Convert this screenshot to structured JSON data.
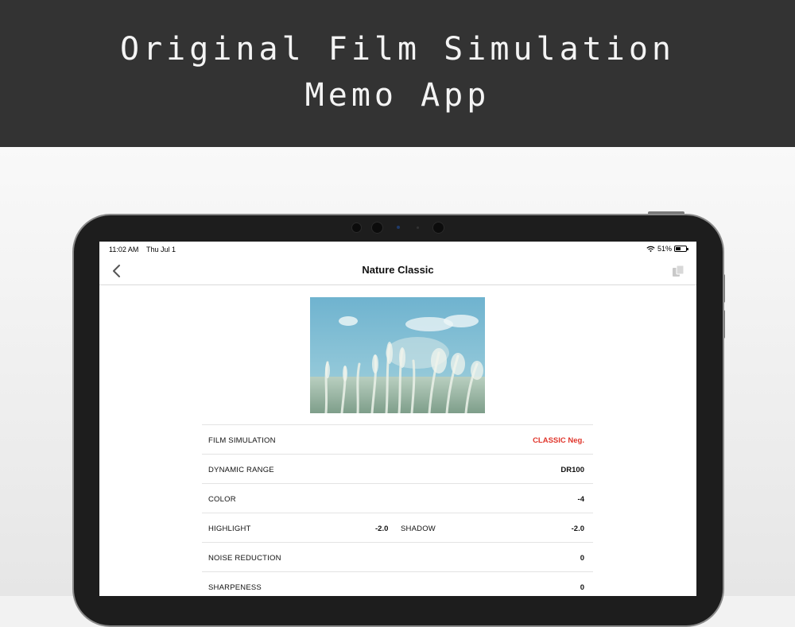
{
  "banner": {
    "line1": "Original Film Simulation",
    "line2": "Memo App"
  },
  "status_bar": {
    "time": "11:02 AM",
    "date": "Thu Jul 1",
    "battery_text": "51%",
    "battery_level": 0.51
  },
  "nav": {
    "title": "Nature Classic",
    "back_icon": "chevron-left-icon",
    "action_icon": "copy-icon"
  },
  "settings": {
    "film_simulation": {
      "label": "FILM SIMULATION",
      "value": "CLASSIC Neg."
    },
    "dynamic_range": {
      "label": "DYNAMIC RANGE",
      "value": "DR100"
    },
    "color": {
      "label": "COLOR",
      "value": "-4"
    },
    "highlight": {
      "label": "HIGHLIGHT",
      "value": "-2.0"
    },
    "shadow": {
      "label": "SHADOW",
      "value": "-2.0"
    },
    "noise_reduction": {
      "label": "NOISE REDUCTION",
      "value": "0"
    },
    "sharpness": {
      "label": "SHARPENESS",
      "value": "0"
    }
  },
  "colors": {
    "banner_bg": "#333333",
    "accent_red": "#e0362c"
  }
}
